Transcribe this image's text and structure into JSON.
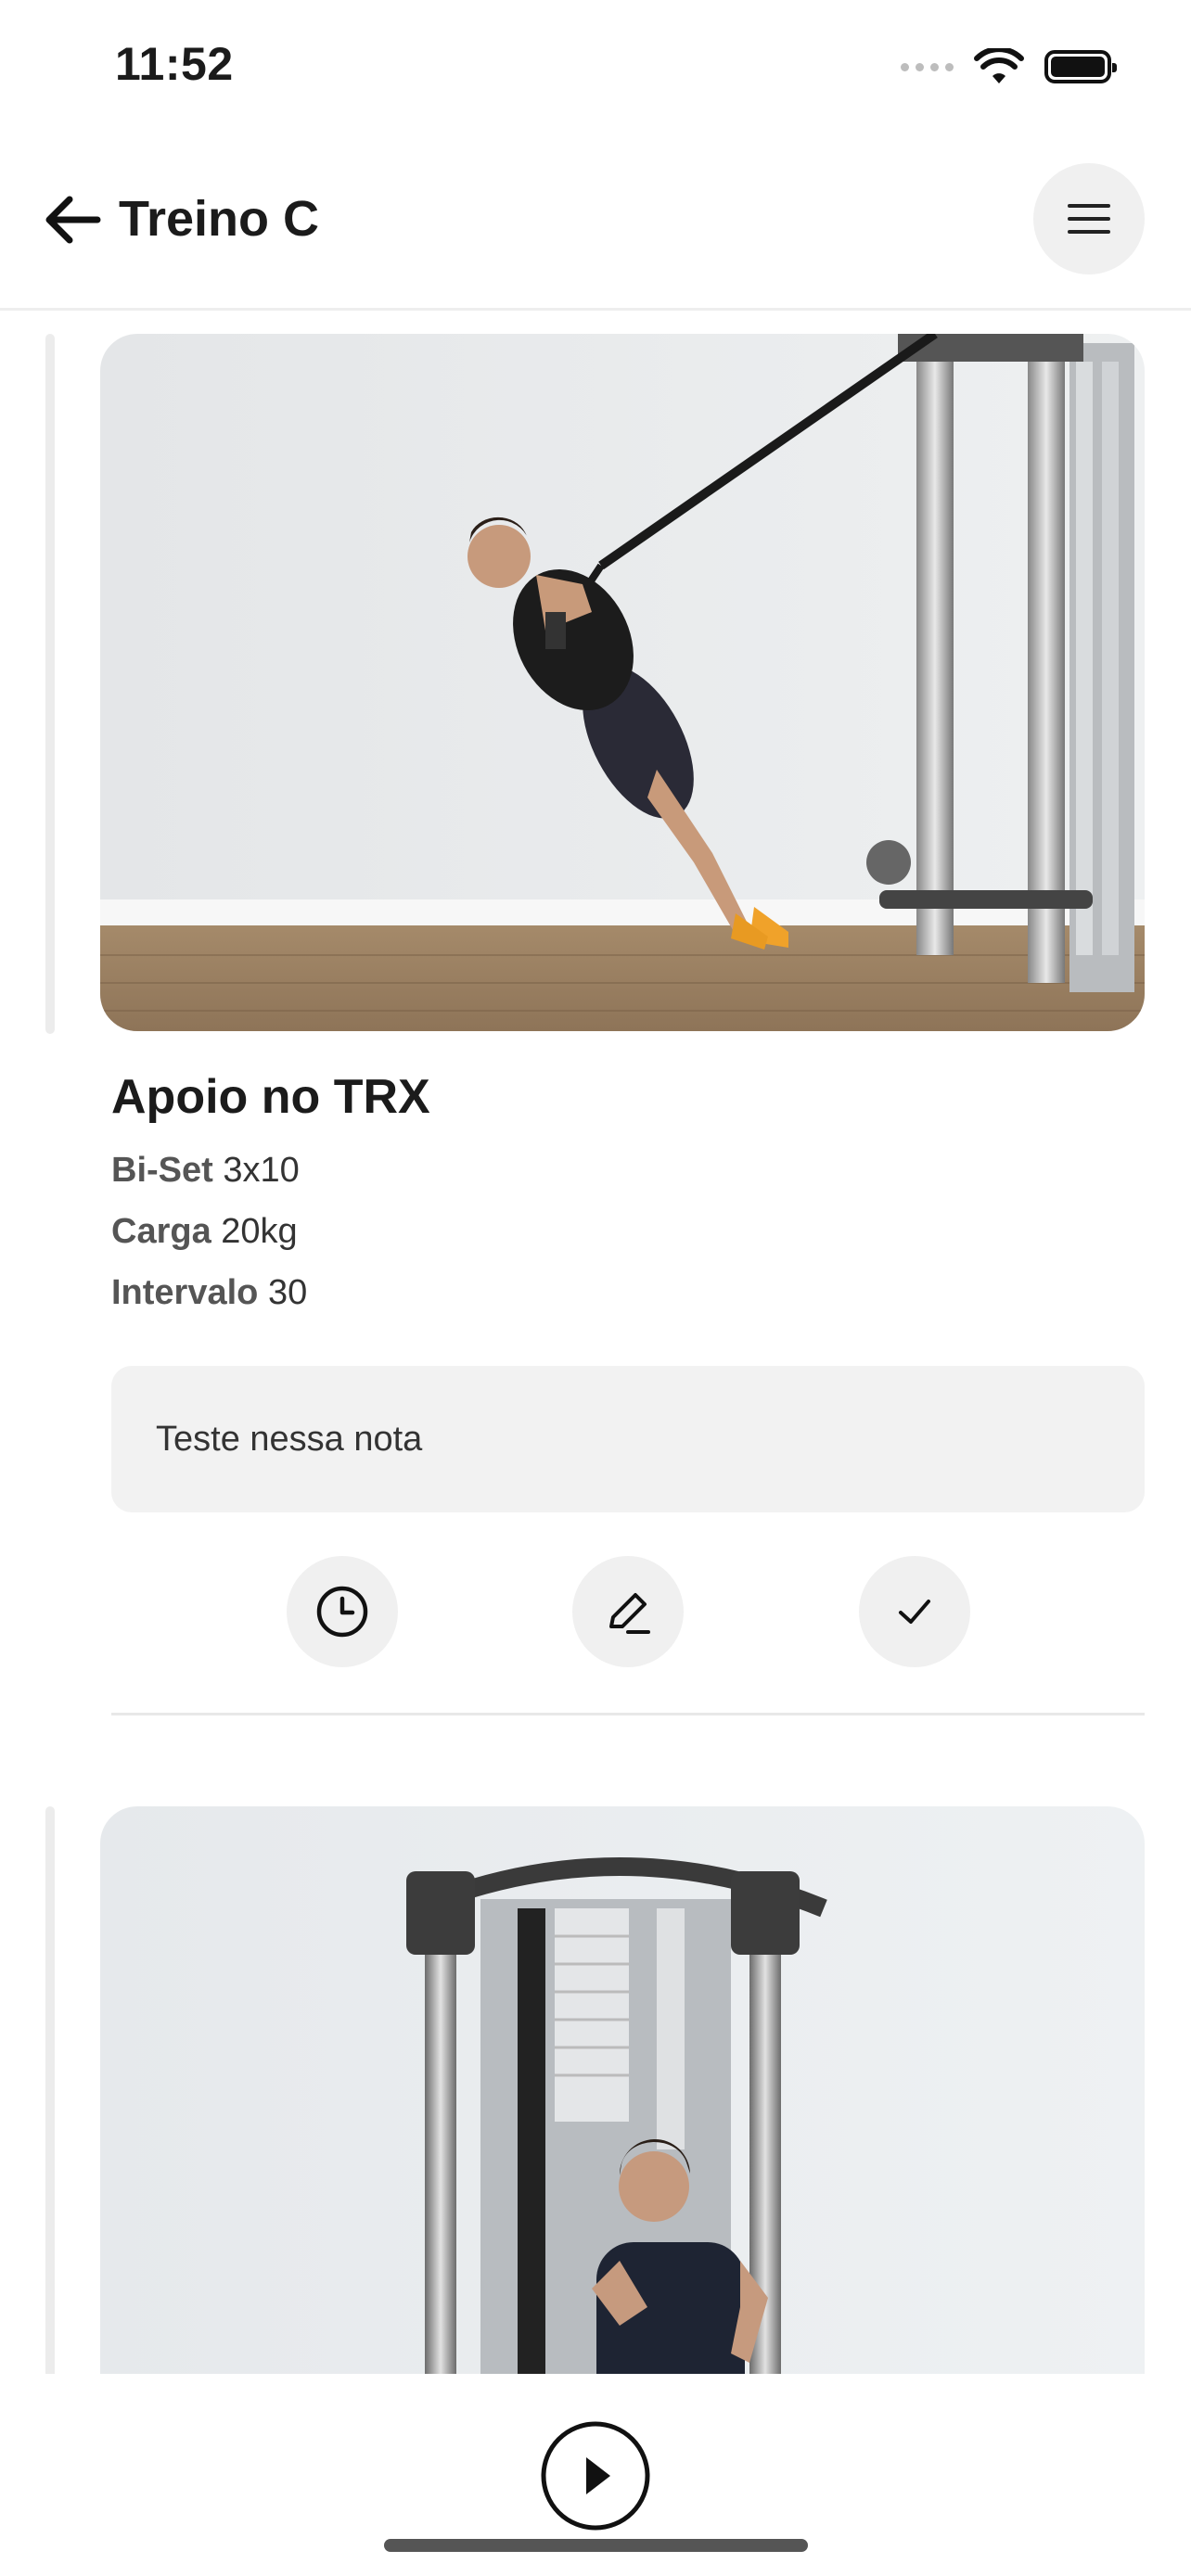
{
  "status_bar": {
    "time": "11:52"
  },
  "header": {
    "title": "Treino C"
  },
  "exercises": [
    {
      "name": "Apoio no TRX",
      "set_label": "Bi-Set",
      "set_value": "3x10",
      "load_label": "Carga",
      "load_value": "20kg",
      "rest_label": "Intervalo",
      "rest_value": "30",
      "note": "Teste nessa nota"
    },
    {
      "name": ""
    }
  ],
  "actions": {
    "timer_icon": "clock-icon",
    "edit_icon": "pencil-icon",
    "done_icon": "check-icon"
  },
  "bottom": {
    "play_icon": "play-icon"
  }
}
